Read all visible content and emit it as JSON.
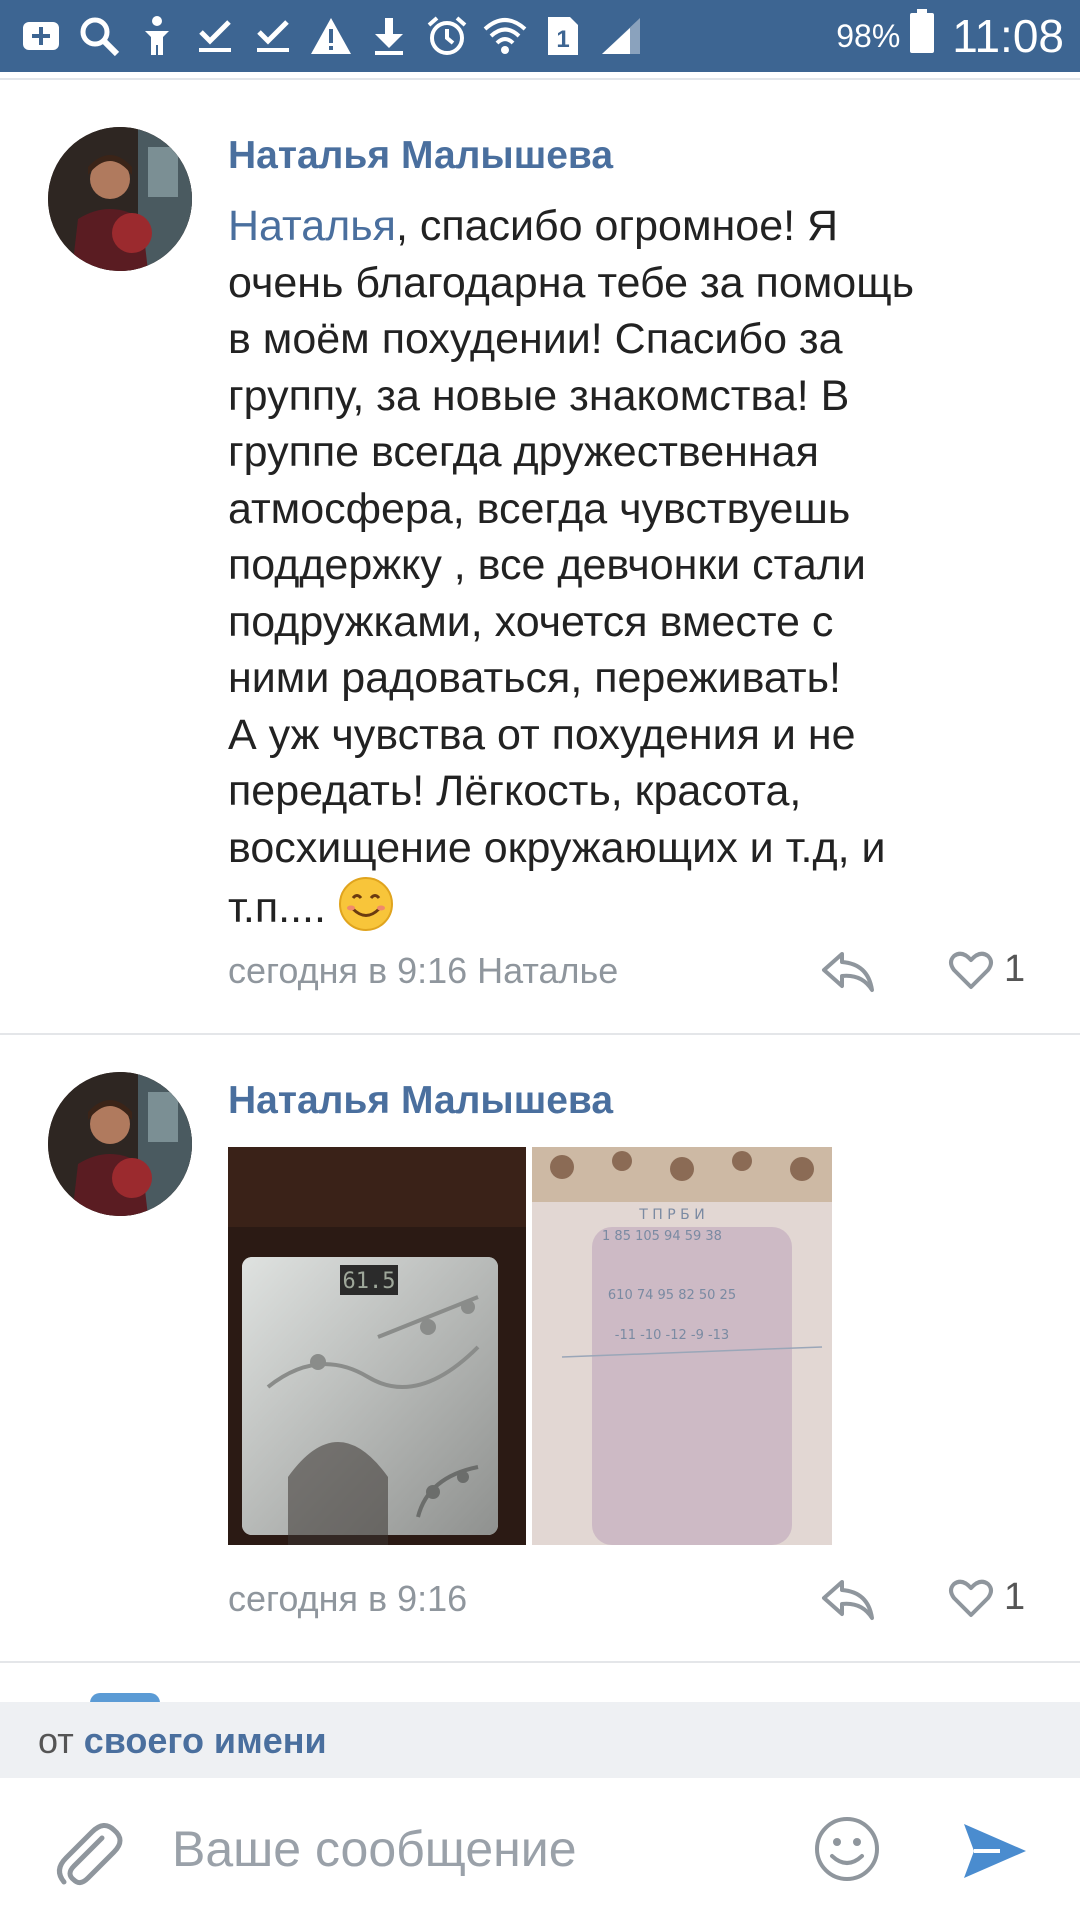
{
  "status_bar": {
    "battery": "98%",
    "time": "11:08",
    "sim_label": "1",
    "icons": [
      "add-icon",
      "search-icon",
      "accessibility-icon",
      "check-icon",
      "check-icon",
      "warning-icon",
      "download-icon",
      "alarm-icon",
      "wifi-icon",
      "sim-icon",
      "signal-icon",
      "battery-icon"
    ]
  },
  "comments": [
    {
      "author": "Наталья Малышева",
      "mention": "Наталья",
      "text_lines": [
        ", спасибо огромное! Я",
        "очень благодарна тебе за помощь",
        "в моём похудении! Спасибо за",
        "группу, за новые знакомства! В",
        "группе всегда дружественная",
        "атмосфера, всегда чувствуешь",
        "поддержку , все девчонки стали",
        "подружками, хочется вместе с",
        "ними радоваться, переживать!",
        "А уж чувства от похудения и не",
        "передать! Лёгкость, красота,",
        "восхищение окружающих и т.д, и",
        "т.п...."
      ],
      "emoji": "😊",
      "meta": "сегодня в 9:16 Наталье",
      "likes": "1"
    },
    {
      "author": "Наталья Малышева",
      "photos": [
        {
          "desc_name": "photo-scale",
          "scale_display": "61.5"
        },
        {
          "desc_name": "photo-notes",
          "row1": "1  85  105  94  59  38",
          "row2": "610  74  95  82  50  25",
          "row3": "-11  -10  -12  -9  -13",
          "headers": "Т  П  Р  Б  И"
        }
      ],
      "meta": "сегодня в 9:16",
      "likes": "1"
    }
  ],
  "composer": {
    "from_prefix": "от",
    "from_link": "своего имени",
    "placeholder": "Ваше сообщение"
  }
}
